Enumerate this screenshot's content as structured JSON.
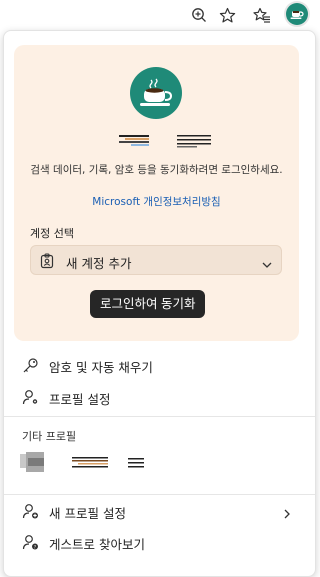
{
  "toolbar": {
    "icons": [
      "zoom-icon",
      "favorite-star-icon",
      "favorites-list-icon",
      "profile-avatar-icon"
    ]
  },
  "account_card": {
    "description": "검색 데이터, 기록, 암호 등을 동기화하려면 로그인하세요.",
    "privacy_link": "Microsoft 개인정보처리방침",
    "account_select_label": "계정 선택",
    "account_select_value": "새 계정 추가",
    "sign_in_button": "로그인하여 동기화"
  },
  "menu": {
    "passwords": "암호 및 자동 채우기",
    "profile_settings": "프로필 설정"
  },
  "other_profiles": {
    "label": "기타 프로필"
  },
  "footer": {
    "new_profile": "새 프로필 설정",
    "guest_browse": "게스트로 찾아보기"
  },
  "colors": {
    "card_bg": "#fdf0e4",
    "avatar_bg": "#1f8a78",
    "link": "#1a5fb4",
    "button_bg": "#262626"
  }
}
